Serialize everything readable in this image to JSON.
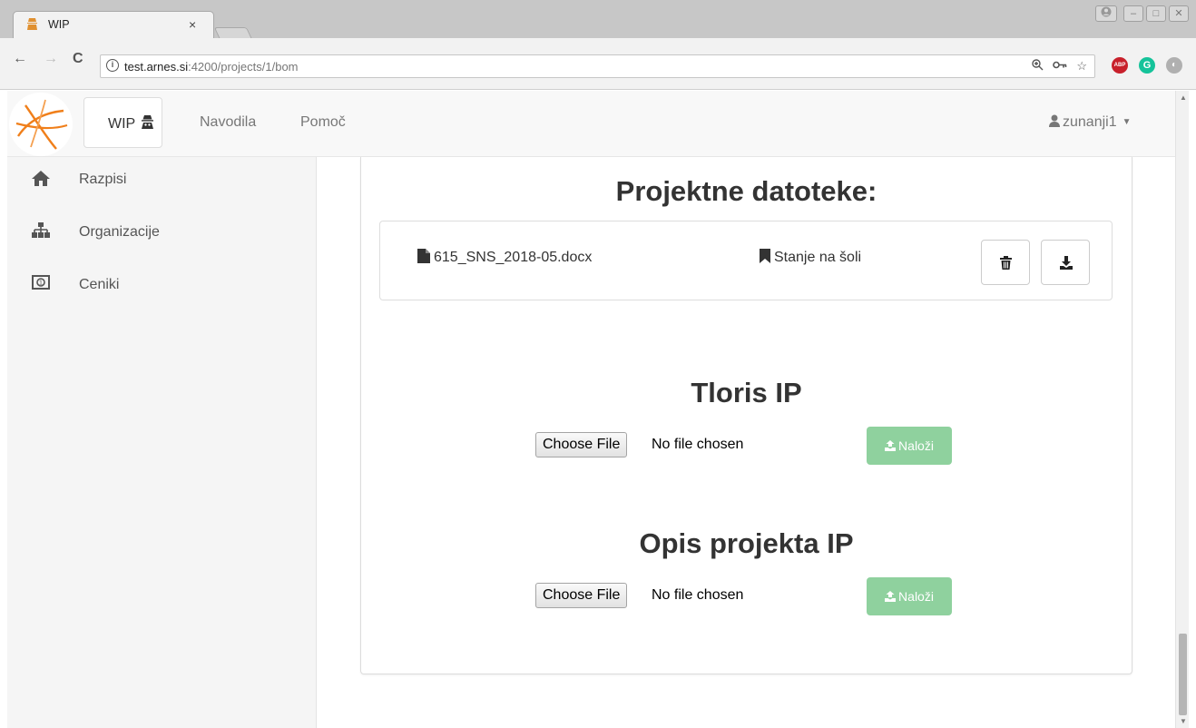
{
  "browser": {
    "tab_title": "WIP",
    "tab_close": "×",
    "url_host": "test.arnes.si",
    "url_path": ":4200/projects/1/bom",
    "ext_abp": "ABP",
    "ext_grammarly": "G"
  },
  "navbar": {
    "brand": "WIP",
    "links": [
      "Navodila",
      "Pomoč"
    ],
    "user": "zunanji1"
  },
  "sidebar": {
    "items": [
      {
        "label": "Razpisi",
        "icon": "home-icon"
      },
      {
        "label": "Organizacije",
        "icon": "sitemap-icon"
      },
      {
        "label": "Ceniki",
        "icon": "money-icon"
      }
    ]
  },
  "main": {
    "files_title": "Projektne datoteke:",
    "files": [
      {
        "name": "615_SNS_2018-05.docx",
        "status": "Stanje na šoli"
      }
    ],
    "uploads": [
      {
        "title": "Tloris IP",
        "choose_label": "Choose File",
        "file_status": "No file chosen",
        "upload_label": "Naloži"
      },
      {
        "title": "Opis projekta IP",
        "choose_label": "Choose File",
        "file_status": "No file chosen",
        "upload_label": "Naloži"
      }
    ]
  },
  "colors": {
    "upload_button": "#8fd19e",
    "logo_accent": "#f07f1a",
    "sidebar_bg": "#f5f5f5",
    "navbar_bg": "#f8f8f8"
  }
}
